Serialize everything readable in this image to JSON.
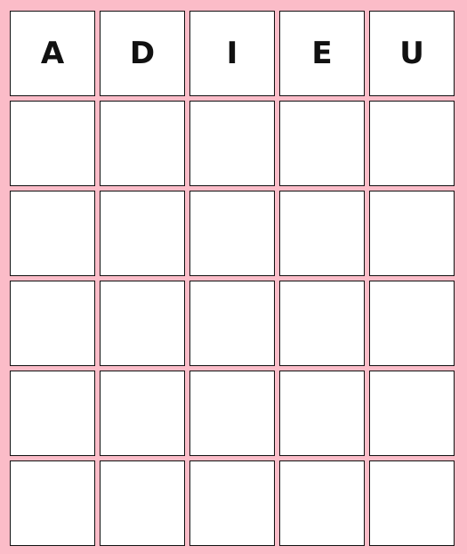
{
  "board": {
    "rows": [
      [
        "A",
        "D",
        "I",
        "E",
        "U"
      ],
      [
        "",
        "",
        "",
        "",
        ""
      ],
      [
        "",
        "",
        "",
        "",
        ""
      ],
      [
        "",
        "",
        "",
        "",
        ""
      ],
      [
        "",
        "",
        "",
        "",
        ""
      ],
      [
        "",
        "",
        "",
        "",
        ""
      ]
    ]
  },
  "colors": {
    "background": "#fbbcc8",
    "tile": "#ffffff",
    "tile_border": "#111111",
    "letter": "#111111"
  }
}
